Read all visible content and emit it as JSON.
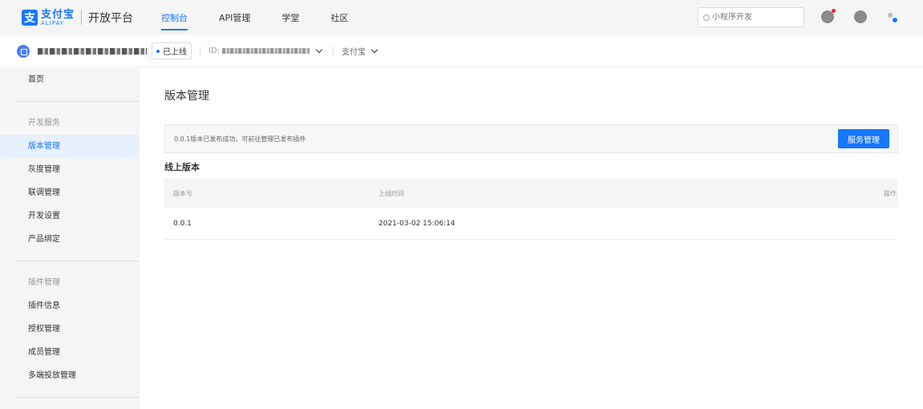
{
  "topnav": {
    "logo_mark": "支",
    "logo_cn": "支付宝",
    "logo_en": "ALIPAY",
    "platform": "开放平台",
    "tabs": [
      {
        "label": "控制台",
        "active": true
      },
      {
        "label": "API管理",
        "active": false
      },
      {
        "label": "学堂",
        "active": false
      },
      {
        "label": "社区",
        "active": false
      }
    ],
    "search_placeholder": "小程序开发"
  },
  "subhead": {
    "status": "已上线",
    "id_label": "ID:",
    "env": "支付宝"
  },
  "sidebar": {
    "items": [
      {
        "label": "首页",
        "type": "item"
      },
      {
        "type": "sep"
      },
      {
        "label": "开发服务",
        "type": "group"
      },
      {
        "label": "版本管理",
        "type": "item",
        "active": true
      },
      {
        "label": "灰度管理",
        "type": "item"
      },
      {
        "label": "联调管理",
        "type": "item"
      },
      {
        "label": "开发设置",
        "type": "item"
      },
      {
        "label": "产品绑定",
        "type": "item"
      },
      {
        "type": "sep"
      },
      {
        "label": "插件管理",
        "type": "group"
      },
      {
        "label": "插件信息",
        "type": "item"
      },
      {
        "label": "授权管理",
        "type": "item"
      },
      {
        "label": "成员管理",
        "type": "item"
      },
      {
        "label": "多端投放管理",
        "type": "item"
      },
      {
        "type": "sep"
      }
    ]
  },
  "main": {
    "title": "版本管理",
    "notice": "0.0.1版本已发布成功，可前往管理已发布插件",
    "notice_button": "服务管理",
    "section_title": "线上版本",
    "table": {
      "headers": [
        "版本号",
        "上线时间",
        "操作"
      ],
      "rows": [
        [
          "0.0.1",
          "2021-03-02 15:06:14",
          ""
        ]
      ]
    }
  },
  "colors": {
    "accent": "#1677ff",
    "notify": "#f5222d"
  }
}
